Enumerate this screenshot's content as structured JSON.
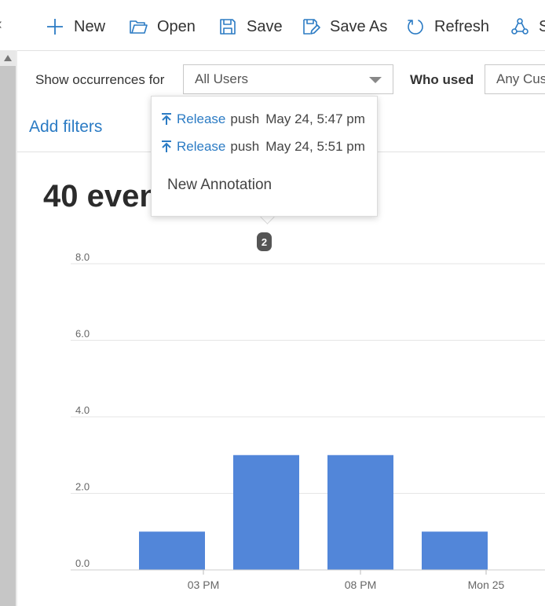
{
  "toolbar": {
    "collapse_glyph": "‹",
    "new_label": "New",
    "open_label": "Open",
    "save_label": "Save",
    "save_as_label": "Save As",
    "refresh_label": "Refresh",
    "share_label": "S"
  },
  "filters": {
    "show_occurrences_label": "Show occurrences for",
    "users_select_value": "All Users",
    "who_used_label": "Who used",
    "who_used_select_value": "Any Cus",
    "add_filters_label": "Add filters"
  },
  "summary": {
    "title": "40 even"
  },
  "annotation_popup": {
    "items": [
      {
        "link": "Release",
        "action": "push",
        "time": "May 24, 5:47 pm"
      },
      {
        "link": "Release",
        "action": "push",
        "time": "May 24, 5:51 pm"
      }
    ],
    "new_annotation_label": "New Annotation",
    "badge_count": "2"
  },
  "colors": {
    "accent": "#2b7bc4",
    "bar": "#5286d9",
    "gridline": "#e6e6e6"
  },
  "chart_data": {
    "type": "bar",
    "categories": [
      "1",
      "2",
      "3",
      "4"
    ],
    "values": [
      1,
      3,
      3,
      1
    ],
    "ylim": [
      0,
      8
    ],
    "yticks": [
      "0.0",
      "2.0",
      "4.0",
      "6.0",
      "8.0"
    ],
    "xtick_labels": [
      "03 PM",
      "08 PM",
      "Mon 25"
    ],
    "grid": true
  }
}
